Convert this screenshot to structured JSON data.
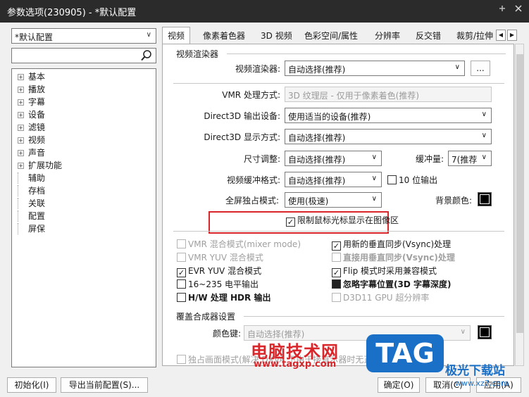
{
  "window": {
    "title": "参数选项(230905) - *默认配置",
    "pin_icon": "pin-icon",
    "close_icon": "close-icon"
  },
  "left": {
    "profile_combo": "*默认配置",
    "search_placeholder": "",
    "tree": [
      {
        "label": "基本",
        "expandable": true
      },
      {
        "label": "播放",
        "expandable": true
      },
      {
        "label": "字幕",
        "expandable": true
      },
      {
        "label": "设备",
        "expandable": true
      },
      {
        "label": "滤镜",
        "expandable": true
      },
      {
        "label": "视频",
        "expandable": true
      },
      {
        "label": "声音",
        "expandable": true
      },
      {
        "label": "扩展功能",
        "expandable": true
      },
      {
        "label": "辅助",
        "expandable": false
      },
      {
        "label": "存档",
        "expandable": false
      },
      {
        "label": "关联",
        "expandable": false
      },
      {
        "label": "配置",
        "expandable": false
      },
      {
        "label": "屏保",
        "expandable": false
      }
    ]
  },
  "tabs": [
    "视频",
    "像素着色器",
    "3D 视频",
    "色彩空间/属性",
    "分辨率",
    "反交错",
    "裁剪/拉伸"
  ],
  "renderer_group": {
    "title": "视频渲染器",
    "renderer_label": "视频渲染器:",
    "renderer_value": "自动选择(推荐)",
    "more_button": "...",
    "vmr_label": "VMR 处理方式:",
    "vmr_value": "3D 纹理层 - 仅用于像素着色(推荐)",
    "d3d_out_label": "Direct3D 输出设备:",
    "d3d_out_value": "使用适当的设备(推荐)",
    "d3d_disp_label": "Direct3D 显示方式:",
    "d3d_disp_value": "自动选择(推荐)",
    "resize_label": "尺寸调整:",
    "resize_value": "自动选择(推荐)",
    "buffer_label": "缓冲量:",
    "buffer_value": "7(推荐",
    "bufformat_label": "视频缓冲格式:",
    "bufformat_value": "自动选择(推荐)",
    "tenbit_label": "10 位输出",
    "fullscreen_label": "全屏独占模式:",
    "fullscreen_value": "使用(极速)",
    "bgcolor_label": "背景颜色:",
    "bgcolor": "#000000",
    "limit_cursor_label": "限制鼠标光标显示在图像区"
  },
  "options": {
    "left": [
      {
        "label": "VMR 混合模式(mixer mode)",
        "checked": false,
        "disabled": true,
        "bold": false
      },
      {
        "label": "VMR YUV 混合模式",
        "checked": false,
        "disabled": true,
        "bold": false
      },
      {
        "label": "EVR YUV 混合模式",
        "checked": true,
        "disabled": false,
        "bold": false
      },
      {
        "label": "16~235 电平输出",
        "checked": false,
        "disabled": false,
        "bold": false
      },
      {
        "label": "H/W 处理 HDR 输出",
        "checked": false,
        "disabled": false,
        "bold": true
      }
    ],
    "right": [
      {
        "label": "用新的垂直同步(Vsync)处理",
        "checked": true,
        "disabled": false,
        "bold": false
      },
      {
        "label": "直接用垂直同步(Vsync)处理",
        "checked": false,
        "disabled": true,
        "bold": true
      },
      {
        "label": "Flip 模式时采用兼容模式",
        "checked": true,
        "disabled": false,
        "bold": false
      },
      {
        "label": "忽略字幕位置(3D 字幕深度)",
        "checked": false,
        "disabled": false,
        "bold": true
      },
      {
        "label": "D3D11 GPU 超分辨率",
        "checked": false,
        "disabled": true,
        "bold": false
      }
    ]
  },
  "overlay_group": {
    "title": "覆盖合成器设置",
    "colorkey_label": "颜色键:",
    "colorkey_value": "自动选择(推荐)",
    "colorkey_swatch": "#000000",
    "exclusive_label": "独占画面模式(解决 DXVA 下由于接直示器时无正面"
  },
  "footer": {
    "init_button": "初始化(I)",
    "export_button": "导出当前配置(S)...",
    "ok_button": "确定(O)",
    "cancel_button": "取消(C)",
    "apply_button": "应用(A)"
  },
  "watermark": {
    "cn_text": "电脑技术网",
    "url": "www.tagxp.com",
    "tag": "TAG",
    "site": "极光下载站",
    "site_url": "www.xz7.com"
  }
}
